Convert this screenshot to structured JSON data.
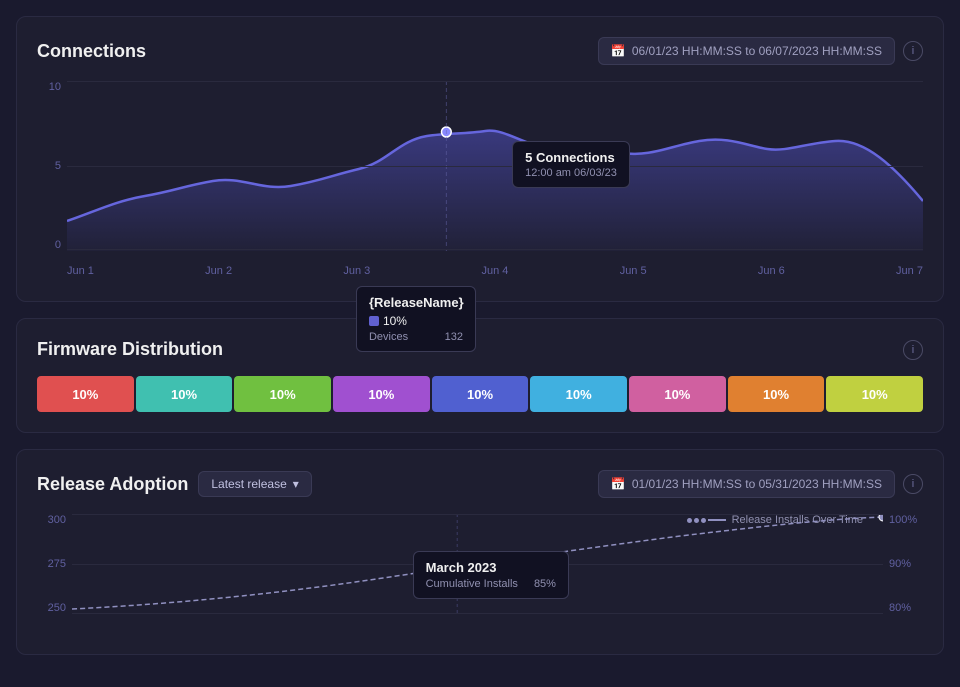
{
  "connections": {
    "title": "Connections",
    "dateRange": "06/01/23 HH:MM:SS to 06/07/2023  HH:MM:SS",
    "yLabels": [
      "10",
      "5",
      "0"
    ],
    "xLabels": [
      "Jun 1",
      "Jun 2",
      "Jun 3",
      "Jun 4",
      "Jun 5",
      "Jun 6",
      "Jun 7"
    ],
    "tooltip": {
      "title": "5 Connections",
      "subtitle": "12:00 am 06/03/23"
    }
  },
  "firmware": {
    "title": "Firmware Distribution",
    "segments": [
      {
        "label": "10%",
        "color": "#e05050"
      },
      {
        "label": "10%",
        "color": "#40c0b0"
      },
      {
        "label": "10%",
        "color": "#70c040"
      },
      {
        "label": "10%",
        "color": "#a050d0"
      },
      {
        "label": "10%",
        "color": "#5060d0"
      },
      {
        "label": "10%",
        "color": "#40b0e0"
      },
      {
        "label": "10%",
        "color": "#d060a0"
      },
      {
        "label": "10%",
        "color": "#e08030"
      },
      {
        "label": "10%",
        "color": "#c0d040"
      }
    ],
    "tooltip": {
      "title": "{ReleaseName}",
      "percent": "10%",
      "devices_label": "Devices",
      "devices_count": "132"
    }
  },
  "releaseAdoption": {
    "title": "Release Adoption",
    "dropdown": "Latest release",
    "dateRange": "01/01/23 HH:MM:SS to 05/31/2023  HH:MM:SS",
    "legendLabel": "Release Installs Over Time",
    "yLeftLabels": [
      "300",
      "275",
      "250"
    ],
    "yRightLabels": [
      "100%",
      "90%",
      "80%"
    ],
    "tooltip": {
      "title": "March 2023",
      "sub_label": "Cumulative Installs",
      "sub_value": "85%"
    }
  }
}
